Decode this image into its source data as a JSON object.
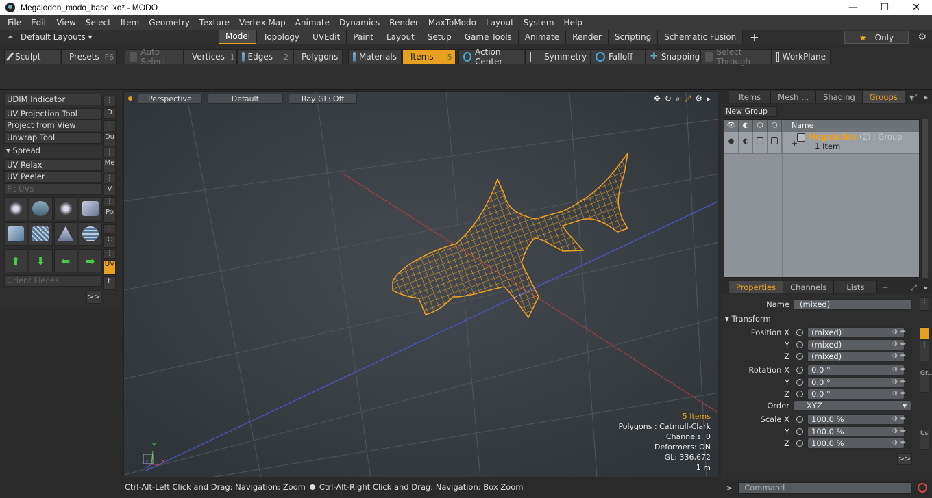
{
  "window": {
    "title": "Megalodon_modo_base.lxo* - MODO",
    "minimize": "—",
    "maximize": "☐",
    "close": "✕"
  },
  "menu": [
    "File",
    "Edit",
    "View",
    "Select",
    "Item",
    "Geometry",
    "Texture",
    "Vertex Map",
    "Animate",
    "Dynamics",
    "Render",
    "MaxToModo",
    "Layout",
    "System",
    "Help"
  ],
  "layoutbar": {
    "default_layouts": "Default Layouts ▾",
    "tabs": [
      "Model",
      "Topology",
      "UVEdit",
      "Paint",
      "Layout",
      "Setup",
      "Game Tools",
      "Animate",
      "Render",
      "Scripting",
      "Schematic Fusion"
    ],
    "active_tab": "Model",
    "only": "Only"
  },
  "toolbar": {
    "sculpt": "Sculpt",
    "presets": "Presets",
    "presets_key": "F6",
    "auto_select": "Auto Select",
    "vertices": "Vertices",
    "vertices_key": "1",
    "edges": "Edges",
    "edges_key": "2",
    "polygons": "Polygons",
    "materials": "Materials",
    "items": "Items",
    "items_key": "5",
    "action_center": "Action Center",
    "symmetry": "Symmetry",
    "falloff": "Falloff",
    "snapping": "Snapping",
    "select_through": "Select Through",
    "workplane": "WorkPlane"
  },
  "left_panel": {
    "items": [
      "UDIM Indicator",
      "UV Projection Tool",
      "Project from View",
      "Unwrap Tool"
    ],
    "spread": "Spread",
    "items2": [
      "UV Relax",
      "UV Peeler"
    ],
    "fit_uvs": "Fit UVs",
    "orient_pieces": "Orient Pieces",
    "more": ">>",
    "vtabs": [
      "⋮",
      "D",
      "⋮",
      "Du",
      "⋮",
      "Me",
      "⋮",
      "V",
      "⋮",
      "Po",
      "⋮",
      "C",
      "⋮",
      "UV",
      "F"
    ]
  },
  "viewport": {
    "view": "Perspective",
    "shading": "Default",
    "raygl": "Ray GL: Off",
    "stats": {
      "items": "5 Items",
      "polygons": "Polygons : Catmull-Clark",
      "channels": "Channels: 0",
      "deformers": "Deformers: ON",
      "gl": "GL: 336,672",
      "scale": "1 m"
    },
    "axis_y": "Y",
    "axis_x": "X",
    "axis_z": "Z"
  },
  "status": {
    "left": "Ctrl-Alt-Left Click and Drag: Navigation: Zoom",
    "right": "Ctrl-Alt-Right Click and Drag: Navigation: Box Zoom"
  },
  "groups_panel": {
    "tabs": [
      "Items",
      "Mesh ...",
      "Shading",
      "Groups"
    ],
    "active_tab": "Groups",
    "new_group": "New Group",
    "col_name": "Name",
    "group_name": "Megalodon",
    "group_meta": " (2) : Group",
    "group_sub": "1 Item"
  },
  "properties_panel": {
    "tabs": [
      "Properties",
      "Channels",
      "Lists"
    ],
    "active_tab": "Properties",
    "name_label": "Name",
    "name_value": "(mixed)",
    "transform": "Transform",
    "position_x_label": "Position X",
    "y_label": "Y",
    "z_label": "Z",
    "mixed": "(mixed)",
    "rotation_x_label": "Rotation X",
    "rot_value": "0.0 °",
    "order_label": "Order",
    "order_value": "XYZ",
    "scale_x_label": "Scale X",
    "scale_value": "100.0 %",
    "more": ">>",
    "side_tabs": [
      "Gr...",
      "Us..."
    ]
  },
  "command": {
    "prompt": ">",
    "placeholder": "Command"
  }
}
